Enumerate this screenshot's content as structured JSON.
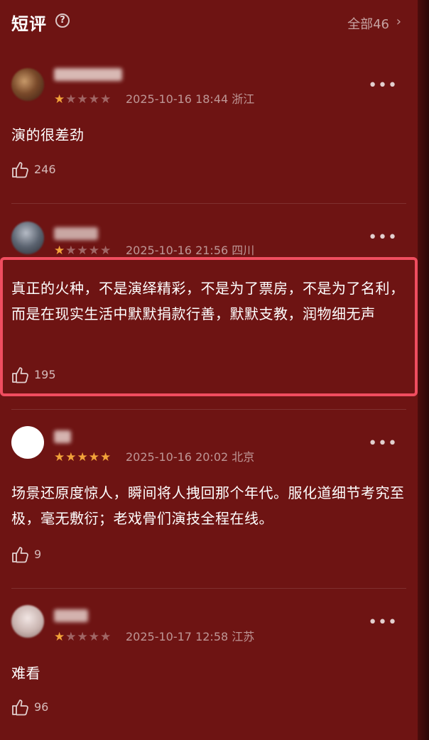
{
  "header": {
    "title": "短评",
    "help_icon": "?",
    "all_label": "全部46",
    "chevron": "›"
  },
  "reviews": [
    {
      "rating": 1,
      "date": "2025-10-16 18:44",
      "location": "浙江",
      "text": "演的很差劲",
      "likes": "246"
    },
    {
      "rating": 1,
      "date": "2025-10-16 21:56",
      "location": "四川",
      "text": "真正的火种，不是演绎精彩，不是为了票房，不是为了名利，而是在现实生活中默默捐款行善，默默支教，润物细无声",
      "likes": "195"
    },
    {
      "rating": 5,
      "date": "2025-10-16 20:02",
      "location": "北京",
      "text": "场景还原度惊人，瞬间将人拽回那个年代。服化道细节考究至极，毫无敷衍；老戏骨们演技全程在线。",
      "likes": "9"
    },
    {
      "rating": 1,
      "date": "2025-10-17 12:58",
      "location": "江苏",
      "text": "难看",
      "likes": "96"
    }
  ],
  "stars": {
    "r1": "★",
    "r1_off": "★★★★",
    "r5": "★★★★★"
  },
  "more_icon": "•••",
  "colors": {
    "background": "#6e1413",
    "star_on": "#f2a33a",
    "highlight": "#f04d5f"
  }
}
